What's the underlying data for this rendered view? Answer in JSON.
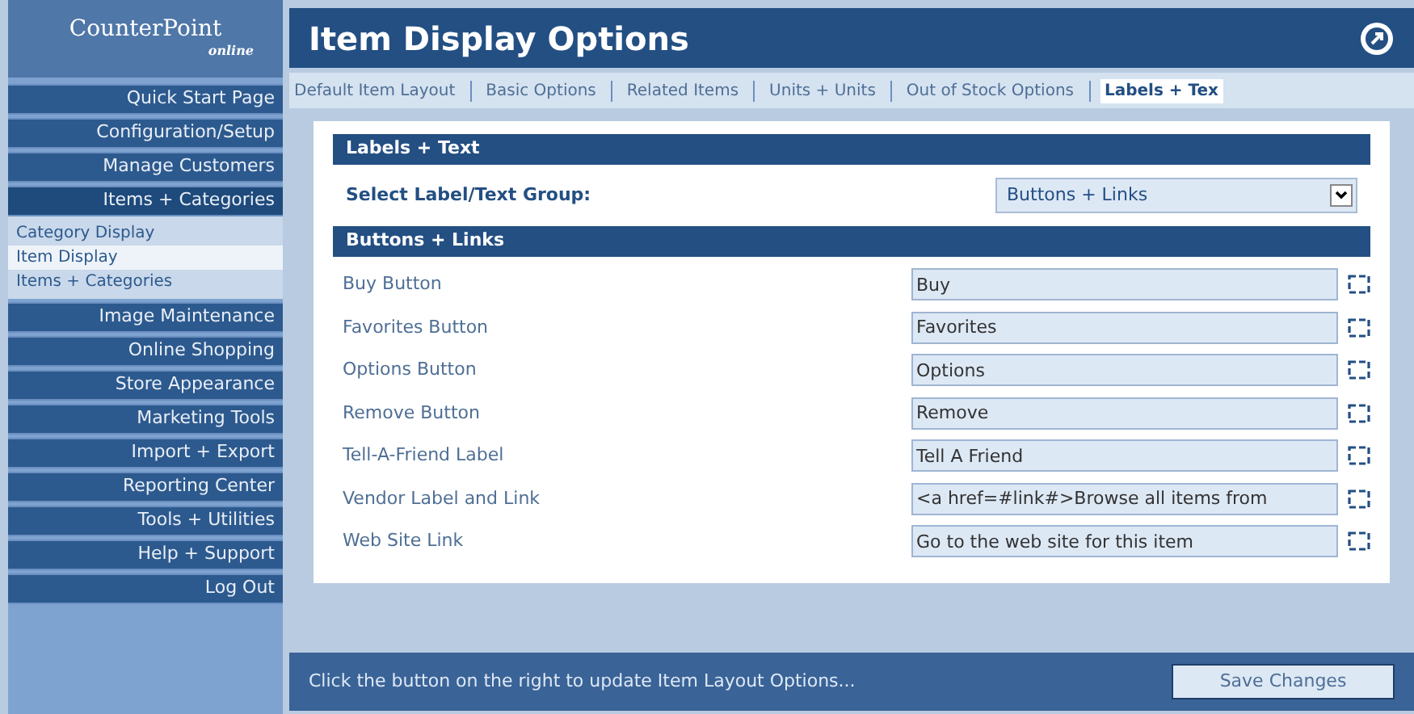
{
  "logo": {
    "name": "CounterPoint",
    "tag": "online"
  },
  "sidebar": {
    "items": [
      {
        "label": "Quick Start Page",
        "expanded": false
      },
      {
        "label": "Configuration/Setup",
        "expanded": false
      },
      {
        "label": "Manage Customers",
        "expanded": false
      },
      {
        "label": "Items + Categories",
        "expanded": true,
        "children": [
          {
            "label": "Category Display",
            "selected": false
          },
          {
            "label": "Item Display",
            "selected": true
          },
          {
            "label": "Items + Categories",
            "selected": false
          }
        ]
      },
      {
        "label": "Image Maintenance",
        "expanded": false
      },
      {
        "label": "Online Shopping",
        "expanded": false
      },
      {
        "label": "Store Appearance",
        "expanded": false
      },
      {
        "label": "Marketing Tools",
        "expanded": false
      },
      {
        "label": "Import + Export",
        "expanded": false
      },
      {
        "label": "Reporting Center",
        "expanded": false
      },
      {
        "label": "Tools + Utilities",
        "expanded": false
      },
      {
        "label": "Help + Support",
        "expanded": false
      },
      {
        "label": "Log Out",
        "expanded": false
      }
    ]
  },
  "window": {
    "title": "Item Display Options"
  },
  "tabs": [
    {
      "label": "Default Item Layout",
      "selected": false
    },
    {
      "label": "Basic Options",
      "selected": false
    },
    {
      "label": "Related Items",
      "selected": false
    },
    {
      "label": "Units + Units",
      "selected": false
    },
    {
      "label": "Out of Stock Options",
      "selected": false
    },
    {
      "label": "Labels + Tex",
      "selected": true
    }
  ],
  "section": {
    "title": "Labels + Text",
    "select_label": "Select Label/Text Group:",
    "select_value": "Buttons + Links"
  },
  "group": {
    "title": "Buttons + Links",
    "rows": [
      {
        "label": "Buy Button",
        "value": "Buy"
      },
      {
        "label": "Favorites Button",
        "value": "Favorites"
      },
      {
        "label": "Options Button",
        "value": "Options"
      },
      {
        "label": "Remove Button",
        "value": "Remove"
      },
      {
        "label": "Tell-A-Friend Label",
        "value": "Tell A Friend"
      },
      {
        "label": "Vendor Label and Link",
        "value": "<a href=#link#>Browse all items from"
      },
      {
        "label": "Web Site Link",
        "value": "Go to the web site for this item"
      }
    ]
  },
  "footer": {
    "hint": "Click the button on the right to update Item Layout Options...",
    "button": "Save Changes"
  }
}
